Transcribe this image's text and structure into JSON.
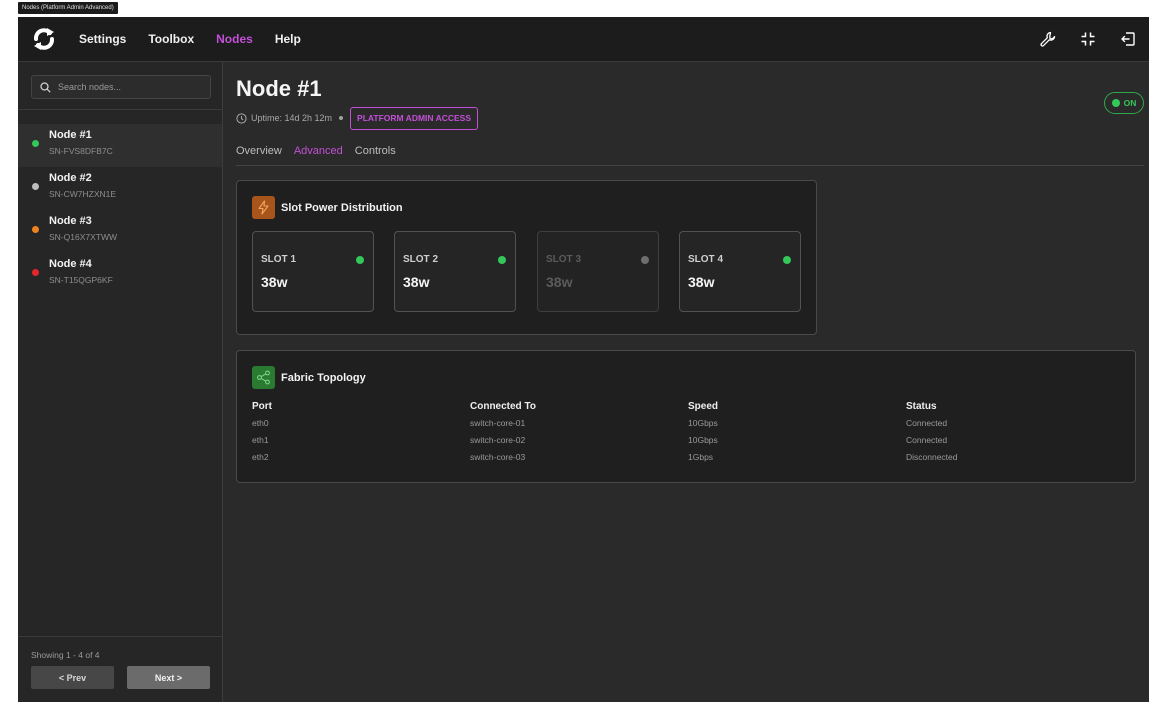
{
  "window_tag": "Nodes (Platform Admin Advanced)",
  "header": {
    "nav": [
      "Settings",
      "Toolbox",
      "Nodes",
      "Help"
    ],
    "active_nav": "Nodes"
  },
  "sidebar": {
    "search_placeholder": "Search nodes...",
    "nodes": [
      {
        "name": "Node #1",
        "serial": "SN-FVS8DFB7C",
        "status_color": "#34c759",
        "selected": true
      },
      {
        "name": "Node #2",
        "serial": "SN-CW7HZXN1E",
        "status_color": "#bdbdbd",
        "selected": false
      },
      {
        "name": "Node #3",
        "serial": "SN-Q16X7XTWW",
        "status_color": "#f0821e",
        "selected": false
      },
      {
        "name": "Node #4",
        "serial": "SN-T15QGP6KF",
        "status_color": "#e5272d",
        "selected": false
      }
    ],
    "showing": "Showing 1 - 4 of 4",
    "prev_label": "< Prev",
    "next_label": "Next >"
  },
  "main": {
    "title": "Node #1",
    "uptime": "Uptime: 14d 2h 12m",
    "badge": "PLATFORM ADMIN ACCESS",
    "toggle_label": "ON",
    "tabs": [
      "Overview",
      "Advanced",
      "Controls"
    ],
    "active_tab": "Advanced",
    "power": {
      "title": "Slot Power Distribution",
      "slots": [
        {
          "label": "SLOT 1",
          "value": "38w",
          "active": true
        },
        {
          "label": "SLOT 2",
          "value": "38w",
          "active": true
        },
        {
          "label": "SLOT 3",
          "value": "38w",
          "active": false
        },
        {
          "label": "SLOT 4",
          "value": "38w",
          "active": true
        }
      ]
    },
    "fabric": {
      "title": "Fabric Topology",
      "columns": [
        "Port",
        "Connected To",
        "Speed",
        "Status"
      ],
      "rows": [
        [
          "eth0",
          "switch-core-01",
          "10Gbps",
          "Connected"
        ],
        [
          "eth1",
          "switch-core-02",
          "10Gbps",
          "Connected"
        ],
        [
          "eth2",
          "switch-core-03",
          "1Gbps",
          "Disconnected"
        ]
      ]
    }
  },
  "colors": {
    "accent": "#c250d6",
    "active_green": "#34c759",
    "inactive_grey": "#6e6e6e"
  }
}
